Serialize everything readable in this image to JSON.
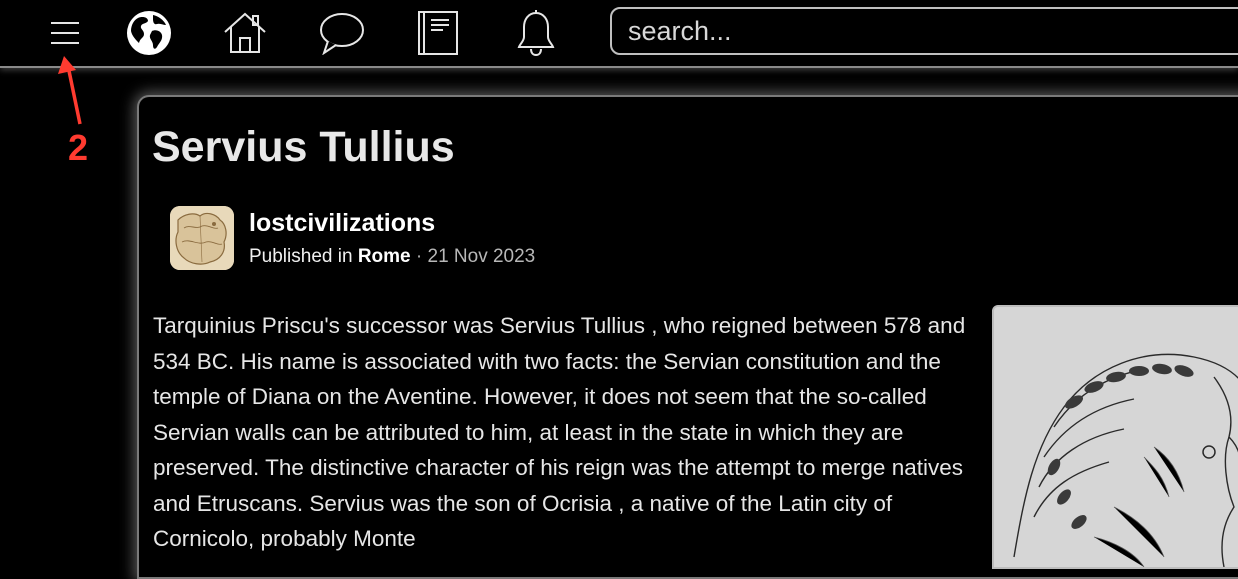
{
  "topbar": {
    "menu_icon": "hamburger-menu-icon",
    "nav_icons": [
      "globe-icon",
      "home-icon",
      "chat-bubble-icon",
      "book-icon",
      "bell-icon"
    ],
    "search": {
      "placeholder": "search...",
      "value": ""
    }
  },
  "annotation": {
    "label": "2",
    "color": "#ff3b30"
  },
  "article": {
    "title": "Servius Tullius",
    "author": "lostcivilizations",
    "published_prefix": "Published in",
    "category": "Rome",
    "separator": "·",
    "date": "21 Nov 2023",
    "body": "Tarquinius Priscu's successor was Servius Tullius , who reigned between 578 and 534 BC. His name is associated with two facts: the Servian constitution and the temple of Diana on the Aventine. However, it does not seem that the so-called Servian walls can be attributed to him, at least in the state in which they are preserved. The distinctive character of his reign was the attempt to merge natives and Etruscans. Servius was the son of Ocrisia , a native of the Latin city of Cornicolo, probably Monte"
  },
  "colors": {
    "background": "#000000",
    "text": "#e6e6e6",
    "accent_annotation": "#ff3b30"
  }
}
